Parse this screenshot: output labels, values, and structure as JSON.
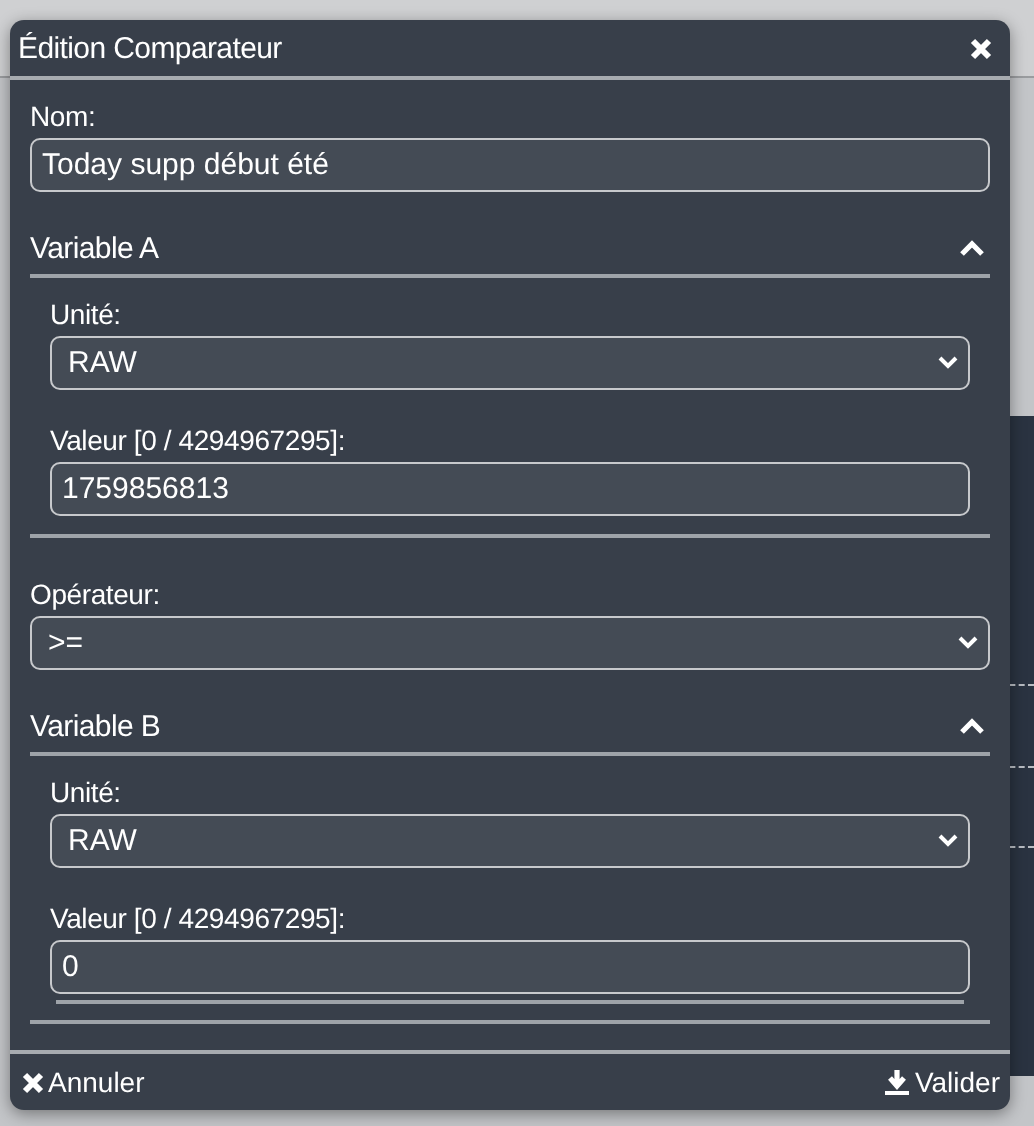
{
  "dialog": {
    "title": "Édition Comparateur",
    "name_field": {
      "label": "Nom:",
      "value": "Today supp début été"
    },
    "variable_a": {
      "title": "Variable A",
      "expanded": true,
      "unit": {
        "label": "Unité:",
        "value": "RAW"
      },
      "value_field": {
        "label": "Valeur [0 / 4294967295]:",
        "value": "1759856813"
      }
    },
    "operator": {
      "label": "Opérateur:",
      "value": ">="
    },
    "variable_b": {
      "title": "Variable B",
      "expanded": true,
      "unit": {
        "label": "Unité:",
        "value": "RAW"
      },
      "value_field": {
        "label": "Valeur [0 / 4294967295]:",
        "value": "0"
      }
    },
    "footer": {
      "cancel": "Annuler",
      "confirm": "Valider"
    }
  }
}
